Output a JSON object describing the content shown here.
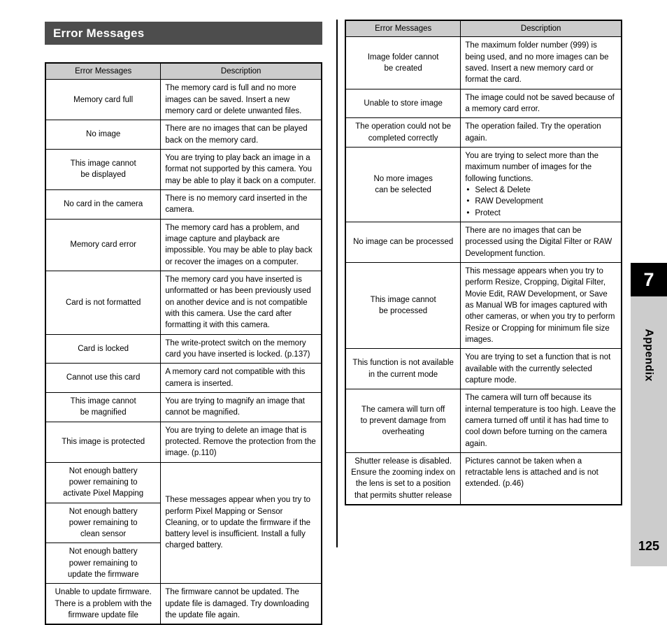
{
  "section": {
    "title": "Error Messages"
  },
  "table_headers": {
    "message": "Error Messages",
    "description": "Description"
  },
  "left_table": {
    "rows": [
      {
        "message": "Memory card full",
        "description": "The memory card is full and no more images can be saved. Insert a new memory card or delete unwanted files."
      },
      {
        "message": "No image",
        "description": "There are no images that can be played back on the memory card."
      },
      {
        "message": "This image cannot\nbe displayed",
        "description": "You are trying to play back an image in a format not supported by this camera. You may be able to play it back on a computer."
      },
      {
        "message": "No card in the camera",
        "description": "There is no memory card inserted in the camera."
      },
      {
        "message": "Memory card error",
        "description": "The memory card has a problem, and image capture and playback are impossible. You may be able to play back or recover the images on a computer."
      },
      {
        "message": "Card is not formatted",
        "description": "The memory card you have inserted is unformatted or has been previously used on another device and is not compatible with this camera. Use the card after formatting it with this camera."
      },
      {
        "message": "Card is locked",
        "description": "The write-protect switch on the memory card you have inserted is locked. (p.137)"
      },
      {
        "message": "Cannot use this card",
        "description": "A memory card not compatible with this camera is inserted."
      },
      {
        "message": "This image cannot\nbe magnified",
        "description": "You are trying to magnify an image that cannot be magnified."
      },
      {
        "message": "This image is protected",
        "description": "You are trying to delete an image that is protected. Remove the protection from the image. (p.110)"
      },
      {
        "message": "Not enough battery\npower remaining to\nactivate Pixel Mapping",
        "description": "These messages appear when you try to perform Pixel Mapping or Sensor Cleaning, or to update the firmware if the battery level is insufficient. Install a fully charged battery."
      },
      {
        "message": "Not enough battery\npower remaining to\nclean sensor",
        "description": ""
      },
      {
        "message": "Not enough battery\npower remaining to\nupdate the firmware",
        "description": ""
      },
      {
        "message": "Unable to update firmware.\nThere is a problem with the\nfirmware update file",
        "description": "The firmware cannot be updated. The update file is damaged. Try downloading the update file again."
      }
    ]
  },
  "right_table": {
    "rows": [
      {
        "message": "Image folder cannot\nbe created",
        "description": "The maximum folder number (999) is being used, and no more images can be saved. Insert a new memory card or format the card."
      },
      {
        "message": "Unable to store image",
        "description": "The image could not be saved because of a memory card error."
      },
      {
        "message": "The operation could not be\ncompleted correctly",
        "description": "The operation failed. Try the operation again."
      },
      {
        "message": "No more images\ncan be selected",
        "description": "You are trying to select more than the maximum number of images for the following functions.",
        "bullets": [
          "Select & Delete",
          "RAW Development",
          "Protect"
        ]
      },
      {
        "message": "No image can be processed",
        "description": "There are no images that can be processed using the Digital Filter or RAW Development function."
      },
      {
        "message": "This image cannot\nbe processed",
        "description": "This message appears when you try to perform Resize, Cropping, Digital Filter, Movie Edit, RAW Development, or Save as Manual WB for images captured with other cameras, or when you try to perform Resize or Cropping for minimum file size images."
      },
      {
        "message": "This function is not available\nin the current mode",
        "description": "You are trying to set a function that is not available with the currently selected capture mode."
      },
      {
        "message": "The camera will turn off\nto prevent damage from\noverheating",
        "description": "The camera will turn off because its internal temperature is too high. Leave the camera turned off until it has had time to cool down before turning on the camera again."
      },
      {
        "message": "Shutter release is disabled.\nEnsure the zooming index on\nthe lens is set to a position\nthat permits shutter release",
        "description": "Pictures cannot be taken when a retractable lens is attached and is not extended. (p.46)"
      }
    ]
  },
  "chapter_tab": {
    "number": "7",
    "name": "Appendix"
  },
  "page_number": "125",
  "bullet_glyph": "•",
  "colors": {
    "title_bar": "#4d4d4d",
    "table_header": "#cccccc",
    "chapter_tab_bg": "#cccccc",
    "chapter_number_bg": "#000000",
    "border": "#000000"
  }
}
